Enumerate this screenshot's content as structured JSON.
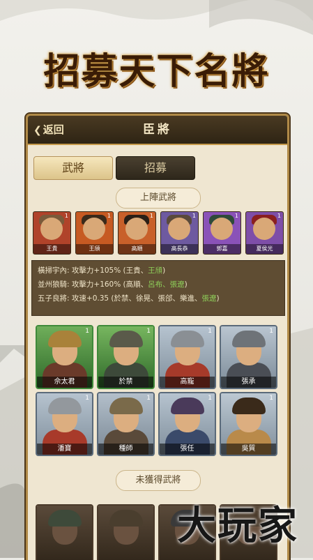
{
  "banner": {
    "title": "招募天下名將"
  },
  "panel": {
    "back_label": "返回",
    "title": "臣將"
  },
  "tabs": [
    {
      "label": "武將",
      "active": true
    },
    {
      "label": "招募",
      "active": false
    }
  ],
  "sections": {
    "lineup_label": "上陣武將",
    "unowned_label": "未獲得武將"
  },
  "lineup": [
    {
      "name": "王貴",
      "level": "1"
    },
    {
      "name": "王頎",
      "level": "1"
    },
    {
      "name": "高順",
      "level": "1"
    },
    {
      "name": "高長恭",
      "level": "1"
    },
    {
      "name": "郭嘉",
      "level": "1"
    },
    {
      "name": "夏侯光",
      "level": "1"
    }
  ],
  "bonuses": [
    {
      "label": "橫掃宇內:",
      "effect": "攻擊力+105% (王貴、",
      "highlight": "王頎",
      "tail": ")"
    },
    {
      "label": "並州狼騎:",
      "effect": "攻擊力+160% (高順、",
      "highlight": "呂布、張遼",
      "tail": ")"
    },
    {
      "label": "五子良將:",
      "effect": "攻速+0.35 (於禁、徐晃、張郃、樂進、",
      "highlight": "張遼",
      "tail": ")"
    },
    {
      "label": "",
      "effect": "",
      "highlight": "",
      "tail": ""
    }
  ],
  "generals": [
    {
      "name": "佘太君",
      "level": "1"
    },
    {
      "name": "於禁",
      "level": "1"
    },
    {
      "name": "高寵",
      "level": "1"
    },
    {
      "name": "張承",
      "level": "1"
    },
    {
      "name": "潘寶",
      "level": "1"
    },
    {
      "name": "種師",
      "level": "1"
    },
    {
      "name": "張任",
      "level": "1"
    },
    {
      "name": "吳質",
      "level": "1"
    }
  ],
  "watermark": {
    "text": "大玩家"
  },
  "colors": {
    "panel_bg": "#efe6d1",
    "header_bg": "#2e2414",
    "gold_border": "#b08a48",
    "highlight_green": "#8fd05a"
  }
}
